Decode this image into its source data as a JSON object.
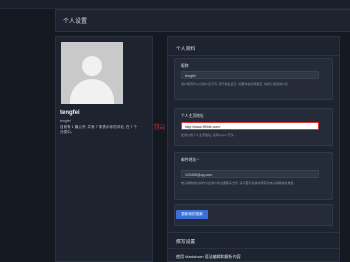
{
  "page": {
    "title": "个人设置"
  },
  "profile": {
    "name": "tengfei",
    "username": "tengfei",
    "bio": "目前有 1 篇公开, 共有 7 条表示你的评论, 在 7 个分类中。"
  },
  "annotation": "修改个人主页地址",
  "sections": {
    "profile_title": "个人资料",
    "writing_title": "撰写设置"
  },
  "fields": {
    "nickname": {
      "label": "昵称",
      "value": "tengfei",
      "help": "用户昵称可以与用户名不同, 用于前台显示. 如果你将此项留空, 将默认使用用户名."
    },
    "homepage": {
      "label": "个人主页地址",
      "value": "http://www.f90de.com/",
      "help": "此用户的个人主页地址, 请用 http:// 开头."
    },
    "email": {
      "label": "邮件地址 *",
      "value": "123456@qq.com",
      "help": "电子邮箱地址将作为此用户的主要联系方式. 请不要与系统中现有的电子邮箱地址重复."
    }
  },
  "buttons": {
    "update": "更新我的档案"
  },
  "writing": {
    "partial_label": "使用 Markdown 语法编辑和解析内容"
  },
  "colors": {
    "background": "#141821",
    "card": "#1e2330",
    "accent": "#3b6fd8",
    "annotation": "#e03333"
  }
}
